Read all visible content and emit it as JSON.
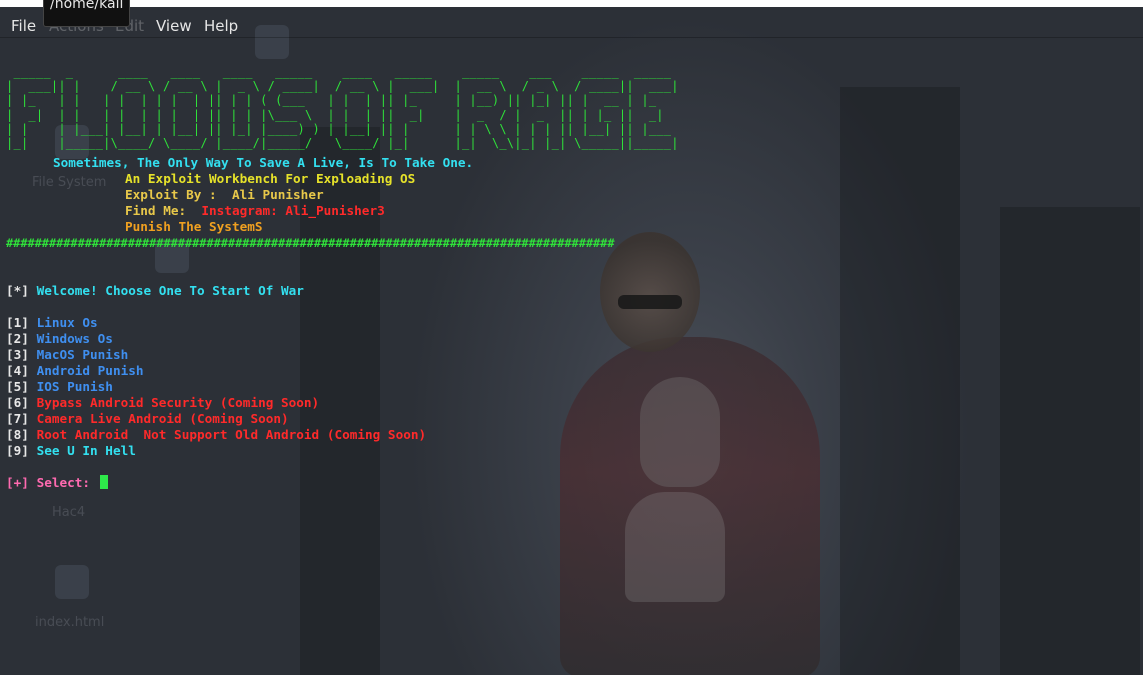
{
  "tooltip": "/home/kali",
  "menu": {
    "file": "File",
    "actions": "Actions",
    "edit": "Edit",
    "view": "View",
    "help": "Help"
  },
  "desktop_ghost": [
    "File System",
    "Hac4",
    "index.html"
  ],
  "banner": {
    "ascii": [
      " _____  _      ____   ____   ____   _____    ____   _____    _____    ___    _____  _____ ",
      "|  ___|| |    / __ \\ / __ \\ |  _ \\ / ____|  / __ \\ |  ___|  |  __ \\  / _ \\  / ____||  ___|",
      "| |_   | |   | |  | | |  | || | | ( (___   | |  | || |_     | |__) || |_| || |  __ | |_   ",
      "|  _|  | |   | |  | | |  | || | | |\\___ \\  | |  | ||  _|    |  _  / |  _  || | |_ ||  _|  ",
      "| |    | |___| |__| | |__| || |_| |____) ) | |__| || |      | | \\ \\ | | | || |__| || |___ ",
      "|_|    |_____|\\____/ \\____/ |____/|_____/   \\____/ |_|      |_|  \\_\\|_| |_| \\_____||_____|"
    ],
    "tagline": "Sometimes, The Only Way To Save A Live, Is To Take One.",
    "subtitle": "An Exploit Workbench For Exploading OS",
    "author_label": "Exploit By :  Ali Punisher",
    "findme_label": "Find Me:",
    "findme_value": "Instagram: Ali_Punisher3",
    "motto": "Punish The SystemS",
    "divider": "#####################################################################################"
  },
  "welcome": {
    "bracket": "[*]",
    "text": "Welcome! Choose One To Start Of War"
  },
  "options": [
    {
      "num": "1",
      "label": "Linux Os",
      "color": "#3f8ff0"
    },
    {
      "num": "2",
      "label": "Windows Os",
      "color": "#3f8ff0"
    },
    {
      "num": "3",
      "label": "MacOS Punish",
      "color": "#3f8ff0"
    },
    {
      "num": "4",
      "label": "Android Punish",
      "color": "#3f8ff0"
    },
    {
      "num": "5",
      "label": "IOS Punish",
      "color": "#3f8ff0"
    },
    {
      "num": "6",
      "label": "Bypass Android Security (Coming Soon)",
      "color": "#ff2a2a"
    },
    {
      "num": "7",
      "label": "Camera Live Android (Coming Soon)",
      "color": "#ff2a2a"
    },
    {
      "num": "8",
      "label": "Root Android  Not Support Old Android (Coming Soon)",
      "color": "#ff2a2a"
    },
    {
      "num": "9",
      "label": "See U In Hell",
      "color": "#33e0f0"
    }
  ],
  "prompt": {
    "bracket": "[+]",
    "label": "Select:"
  }
}
